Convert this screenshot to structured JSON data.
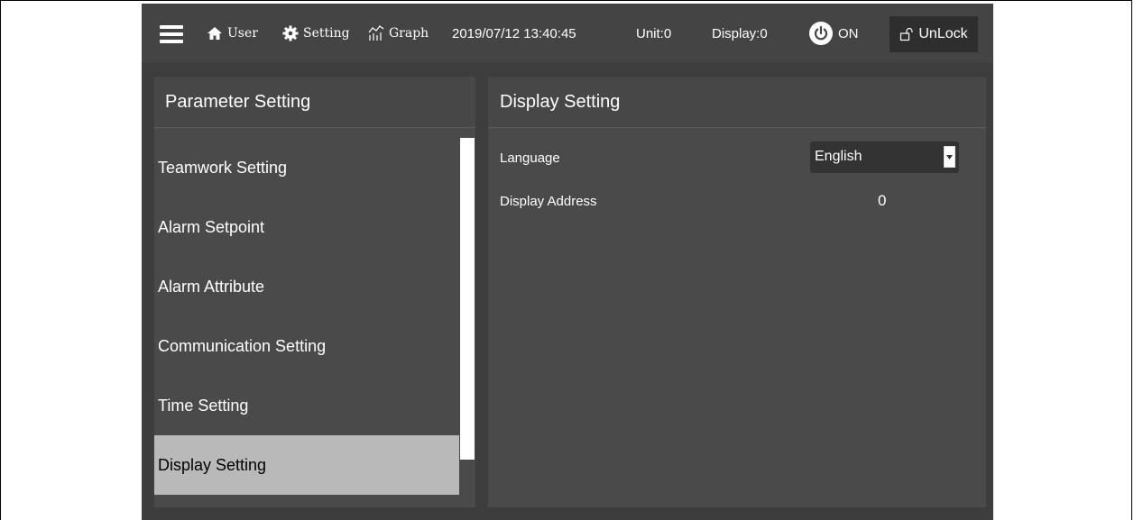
{
  "topbar": {
    "user_label": "User",
    "setting_label": "Setting",
    "graph_label": "Graph",
    "datetime": "2019/07/12 13:40:45",
    "unit": "Unit:0",
    "display": "Display:0",
    "power_state": "ON",
    "unlock_label": "UnLock"
  },
  "left_panel": {
    "title": "Parameter Setting",
    "items": [
      {
        "label": "Teamwork Setting"
      },
      {
        "label": "Alarm Setpoint"
      },
      {
        "label": "Alarm Attribute"
      },
      {
        "label": "Communication Setting"
      },
      {
        "label": "Time Setting"
      },
      {
        "label": "Display Setting",
        "selected": true
      }
    ]
  },
  "right_panel": {
    "title": "Display Setting",
    "language_label": "Language",
    "language_value": "English",
    "display_address_label": "Display Address",
    "display_address_value": "0"
  },
  "colors": {
    "background": "#3d3d3d",
    "panel": "#4a4a4a",
    "selected_item": "#b9b9b9",
    "text": "#ffffff"
  },
  "icons": [
    "menu-icon",
    "home-icon",
    "gear-icon",
    "graph-icon",
    "power-icon",
    "unlock-icon",
    "dropdown-arrow-icon"
  ]
}
